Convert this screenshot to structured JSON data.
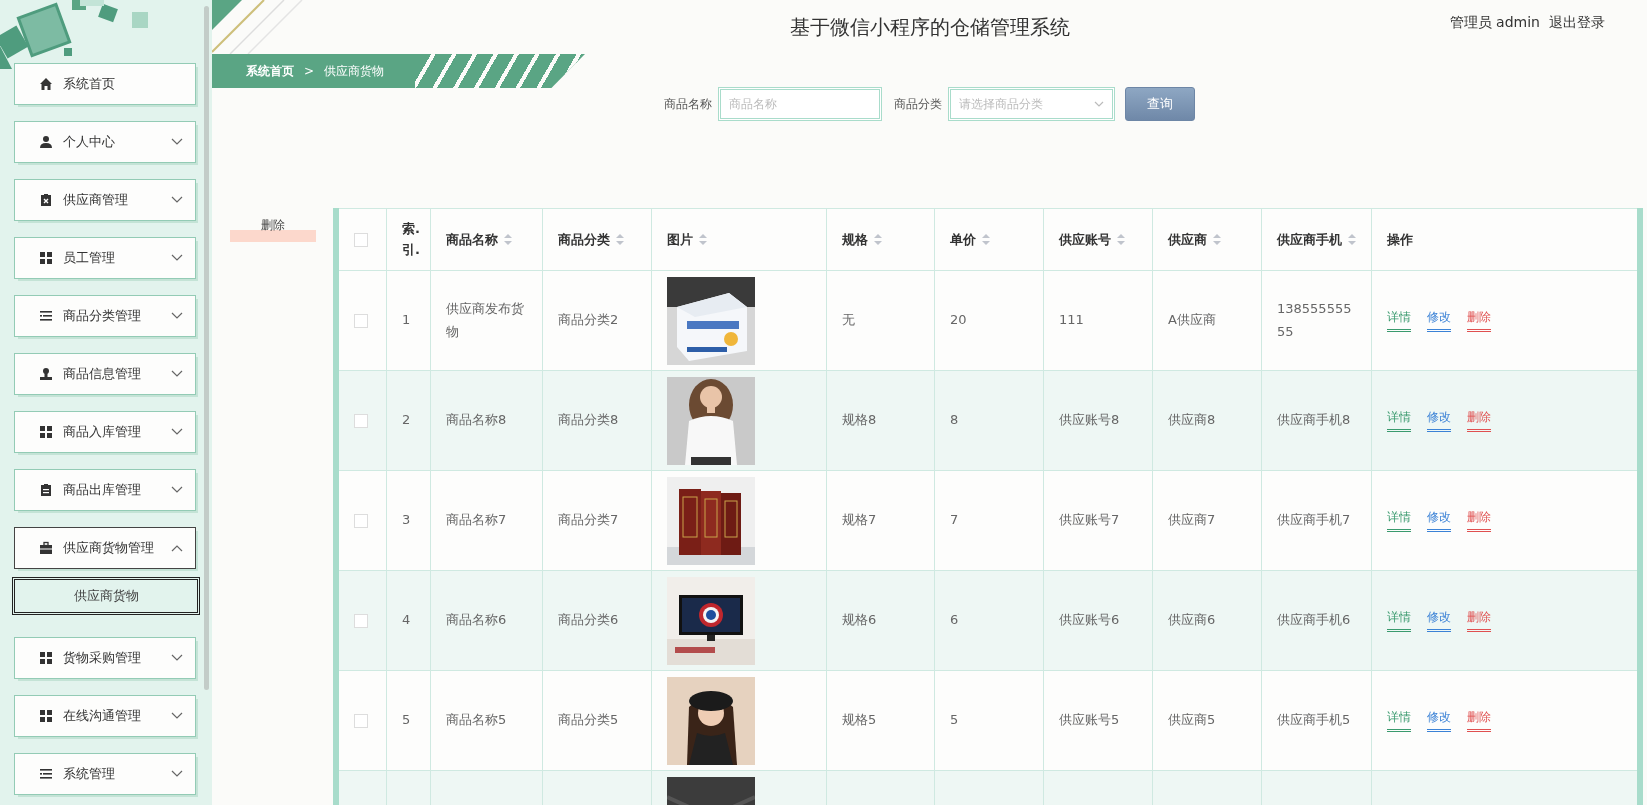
{
  "header": {
    "title": "基于微信小程序的仓储管理系统",
    "user": "管理员 admin",
    "logout": "退出登录"
  },
  "sidebar": {
    "items": [
      {
        "label": "系统首页",
        "expandable": false,
        "expanded": false
      },
      {
        "label": "个人中心",
        "expandable": true,
        "expanded": false
      },
      {
        "label": "供应商管理",
        "expandable": true,
        "expanded": false
      },
      {
        "label": "员工管理",
        "expandable": true,
        "expanded": false
      },
      {
        "label": "商品分类管理",
        "expandable": true,
        "expanded": false
      },
      {
        "label": "商品信息管理",
        "expandable": true,
        "expanded": false
      },
      {
        "label": "商品入库管理",
        "expandable": true,
        "expanded": false
      },
      {
        "label": "商品出库管理",
        "expandable": true,
        "expanded": false
      },
      {
        "label": "供应商货物管理",
        "expandable": true,
        "expanded": true,
        "children": [
          {
            "label": "供应商货物",
            "selected": true
          }
        ]
      },
      {
        "label": "货物采购管理",
        "expandable": true,
        "expanded": false
      },
      {
        "label": "在线沟通管理",
        "expandable": true,
        "expanded": false
      },
      {
        "label": "系统管理",
        "expandable": true,
        "expanded": false
      }
    ]
  },
  "breadcrumb": {
    "items": [
      "系统首页",
      "供应商货物"
    ],
    "separator": ">"
  },
  "search": {
    "fields": [
      {
        "label": "商品名称",
        "placeholder": "商品名称",
        "kind": "text"
      },
      {
        "label": "商品分类",
        "placeholder": "请选择商品分类",
        "kind": "select"
      }
    ],
    "button": "查询"
  },
  "delete_button": "删除",
  "table": {
    "columns": [
      {
        "kind": "checkbox",
        "checked": false
      },
      {
        "kind": "text",
        "label": "索.引.",
        "sortable": false
      },
      {
        "kind": "text",
        "label": "商品名称",
        "sortable": true
      },
      {
        "kind": "text",
        "label": "商品分类",
        "sortable": true
      },
      {
        "kind": "text",
        "label": "图片",
        "sortable": true
      },
      {
        "kind": "text",
        "label": "规格",
        "sortable": true
      },
      {
        "kind": "text",
        "label": "单价",
        "sortable": true
      },
      {
        "kind": "text",
        "label": "供应账号",
        "sortable": true
      },
      {
        "kind": "text",
        "label": "供应商",
        "sortable": true
      },
      {
        "kind": "text",
        "label": "供应商手机",
        "sortable": true
      },
      {
        "kind": "text",
        "label": "操作",
        "sortable": false
      }
    ],
    "rows": [
      {
        "checked": false,
        "index": "1",
        "name": "供应商发布货物",
        "category": "商品分类2",
        "image": {
          "kind": "picture"
        },
        "spec": "无",
        "price": "20",
        "account": "111",
        "supplier": "A供应商",
        "phone": "13855555555",
        "actions": [
          {
            "label": "详情",
            "kind": "detail"
          },
          {
            "label": "修改",
            "kind": "edit"
          },
          {
            "label": "删除",
            "kind": "delete"
          }
        ]
      },
      {
        "checked": false,
        "index": "2",
        "name": "商品名称8",
        "category": "商品分类8",
        "image": {
          "kind": "picture"
        },
        "spec": "规格8",
        "price": "8",
        "account": "供应账号8",
        "supplier": "供应商8",
        "phone": "供应商手机8",
        "actions": [
          {
            "label": "详情",
            "kind": "detail"
          },
          {
            "label": "修改",
            "kind": "edit"
          },
          {
            "label": "删除",
            "kind": "delete"
          }
        ]
      },
      {
        "checked": false,
        "index": "3",
        "name": "商品名称7",
        "category": "商品分类7",
        "image": {
          "kind": "picture"
        },
        "spec": "规格7",
        "price": "7",
        "account": "供应账号7",
        "supplier": "供应商7",
        "phone": "供应商手机7",
        "actions": [
          {
            "label": "详情",
            "kind": "detail"
          },
          {
            "label": "修改",
            "kind": "edit"
          },
          {
            "label": "删除",
            "kind": "delete"
          }
        ]
      },
      {
        "checked": false,
        "index": "4",
        "name": "商品名称6",
        "category": "商品分类6",
        "image": {
          "kind": "picture"
        },
        "spec": "规格6",
        "price": "6",
        "account": "供应账号6",
        "supplier": "供应商6",
        "phone": "供应商手机6",
        "actions": [
          {
            "label": "详情",
            "kind": "detail"
          },
          {
            "label": "修改",
            "kind": "edit"
          },
          {
            "label": "删除",
            "kind": "delete"
          }
        ]
      },
      {
        "checked": false,
        "index": "5",
        "name": "商品名称5",
        "category": "商品分类5",
        "image": {
          "kind": "picture"
        },
        "spec": "规格5",
        "price": "5",
        "account": "供应账号5",
        "supplier": "供应商5",
        "phone": "供应商手机5",
        "actions": [
          {
            "label": "详情",
            "kind": "detail"
          },
          {
            "label": "修改",
            "kind": "edit"
          },
          {
            "label": "删除",
            "kind": "delete"
          }
        ]
      },
      {
        "image": {
          "kind": "picture"
        }
      }
    ]
  }
}
